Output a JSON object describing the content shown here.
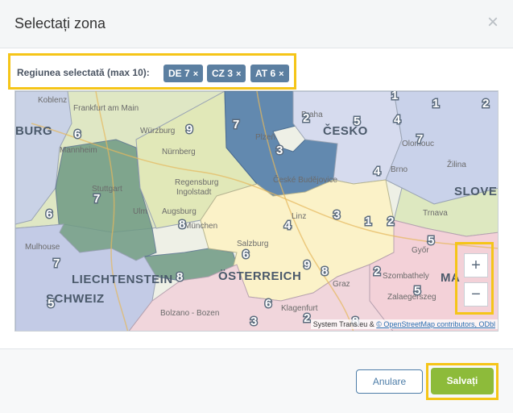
{
  "dialog": {
    "title": "Selectați zona",
    "close_glyph": "×"
  },
  "region": {
    "label": "Regiunea selectată (max 10):",
    "tags": [
      {
        "label": "DE 7",
        "remove": "×"
      },
      {
        "label": "CZ 3",
        "remove": "×"
      },
      {
        "label": "AT 6",
        "remove": "×"
      }
    ]
  },
  "map": {
    "places": [
      "Koblenz",
      "Frankfurt am Main",
      "Würzburg",
      "Mannheim",
      "Nürnberg",
      "Stuttgart",
      "Regensburg",
      "Ingolstadt",
      "Ulm",
      "Augsburg",
      "München",
      "Plzeň",
      "Praha",
      "České Budějovice",
      "Brno",
      "Olomouc",
      "Žilina",
      "Trnava",
      "Linz",
      "Salzburg",
      "Graz",
      "Klagenfurt",
      "Győr",
      "Szombathely",
      "Zalaegerszeg",
      "Bolzano - Bozen",
      "Mulhouse"
    ],
    "countries": [
      "BURG",
      "ČESKO",
      "SLOVEN",
      "LIECHTENSTEIN",
      "ÖSTERREICH",
      "SCHWEIZ",
      "MA"
    ],
    "zone_numbers": [
      "6",
      "9",
      "7",
      "8",
      "2",
      "3",
      "5",
      "4",
      "1",
      "6",
      "3",
      "2",
      "7",
      "5",
      "4",
      "4",
      "1",
      "1",
      "2",
      "7",
      "9",
      "6",
      "8",
      "8",
      "2",
      "5",
      "3",
      "8",
      "2",
      "5",
      "7",
      "6"
    ],
    "zoom_in": "+",
    "zoom_out": "−",
    "attribution_text": "System Trans.eu & ",
    "attribution_link": "© OpenStreetMap contributors, ODbl"
  },
  "footer": {
    "cancel_label": "Anulare",
    "save_label": "Salvați"
  },
  "colors": {
    "selected_zone": "#5b84ad",
    "tag_bg": "#5b7fa1",
    "save_button": "#8dbb3a",
    "highlight": "#f5c518",
    "cancel_border": "#4d7da8"
  }
}
